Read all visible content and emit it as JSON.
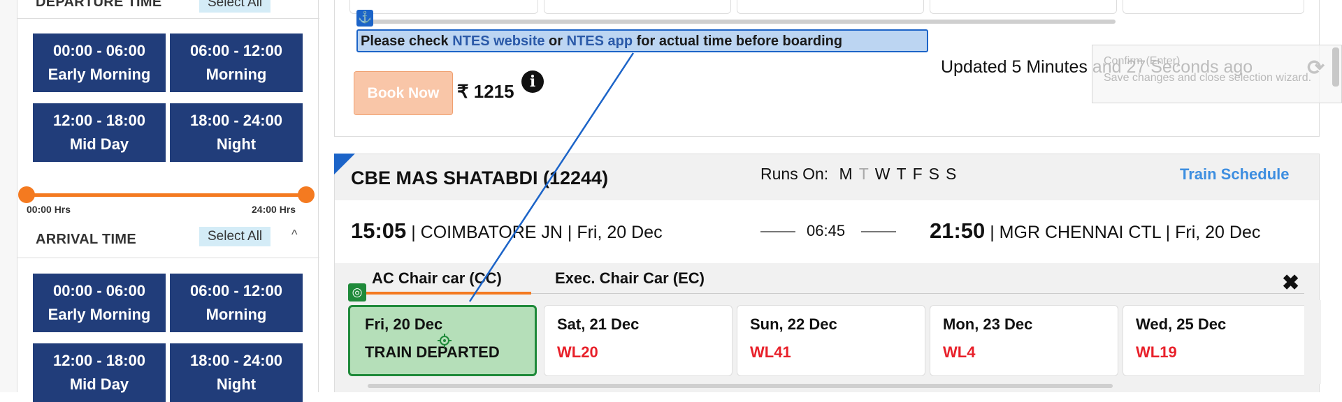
{
  "filters": {
    "departure": {
      "title": "DEPARTURE TIME",
      "select_all": "Select All",
      "slots": [
        {
          "time": "00:00 - 06:00",
          "label": "Early Morning"
        },
        {
          "time": "06:00 - 12:00",
          "label": "Morning"
        },
        {
          "time": "12:00 - 18:00",
          "label": "Mid Day"
        },
        {
          "time": "18:00 - 24:00",
          "label": "Night"
        }
      ],
      "range_start": "00:00 Hrs",
      "range_end": "24:00 Hrs"
    },
    "arrival": {
      "title": "ARRIVAL TIME",
      "select_all": "Select All",
      "slots": [
        {
          "time": "00:00 - 06:00",
          "label": "Early Morning"
        },
        {
          "time": "06:00 - 12:00",
          "label": "Morning"
        },
        {
          "time": "12:00 - 18:00",
          "label": "Mid Day"
        },
        {
          "time": "18:00 - 24:00",
          "label": "Night"
        }
      ]
    }
  },
  "notice": {
    "pre": "Please check ",
    "link1": "NTES website",
    "mid": " or ",
    "link2": "NTES app",
    "post": " for actual time before boarding"
  },
  "booking": {
    "book_label": "Book Now",
    "price": "₹ 1215",
    "info_glyph": "i",
    "updated": "Updated 5 Minutes and 27 Seconds ago",
    "refresh_glyph": "⟳"
  },
  "tooltip": {
    "title": "Confirm (Enter)",
    "desc": "Save changes and close selection wizard."
  },
  "train": {
    "name": "CBE MAS SHATABDI (12244)",
    "runs_on_label": "Runs On:",
    "days": [
      {
        "d": "M",
        "runs": true
      },
      {
        "d": "T",
        "runs": false
      },
      {
        "d": "W",
        "runs": true
      },
      {
        "d": "T",
        "runs": true
      },
      {
        "d": "F",
        "runs": true
      },
      {
        "d": "S",
        "runs": true
      },
      {
        "d": "S",
        "runs": true
      }
    ],
    "schedule_link": "Train Schedule",
    "dep_time": "15:05",
    "dep_station": " | COIMBATORE JN | Fri, 20 Dec",
    "duration": "06:45",
    "arr_time": "21:50",
    "arr_station": " | MGR CHENNAI CTL | Fri, 20 Dec",
    "classes": [
      "AC Chair car (CC)",
      "Exec. Chair Car (EC)"
    ],
    "close_glyph": "✖",
    "dates": [
      {
        "date": "Fri, 20 Dec",
        "status": "TRAIN DEPARTED"
      },
      {
        "date": "Sat, 21 Dec",
        "status": "WL20"
      },
      {
        "date": "Sun, 22 Dec",
        "status": "WL41"
      },
      {
        "date": "Mon, 23 Dec",
        "status": "WL4"
      },
      {
        "date": "Wed, 25 Dec",
        "status": "WL19"
      }
    ]
  },
  "badges": {
    "anchor": "⚓",
    "target": "◎"
  }
}
